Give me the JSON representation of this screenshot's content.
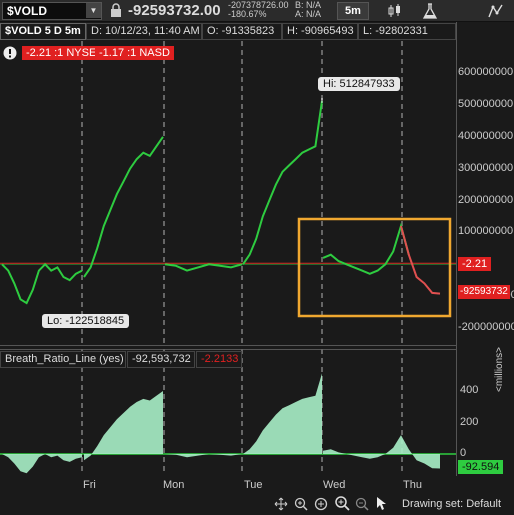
{
  "toolbar": {
    "symbol": "$VOLD",
    "last_price": "-92593732.00",
    "net_change": "-207378726.00",
    "pct_change": "-180.67%",
    "bid": "B: N/A",
    "ask": "A: N/A",
    "timeframe": "5m",
    "icons": [
      "lock-icon",
      "chart-style-icon",
      "flask-icon",
      "drawing-tools-icon"
    ]
  },
  "header": {
    "title": "$VOLD 5 D 5m",
    "date_time": "D: 10/12/23, 11:40 AM",
    "open": "O: -91335823",
    "high": "H: -90965493",
    "low": "L: -92802331",
    "nyse_ratio": "-2.21 :1 NYSE",
    "nasd_ratio": "-1.17 :1 NASD",
    "alert_icon": "exclamation-icon",
    "trend_icon": "trend-line-icon"
  },
  "main_chart": {
    "hi_label": "Hi: 512847933",
    "lo_label": "Lo: -122518845",
    "ratio_badge": "-2.21",
    "price_badge": "-92593732",
    "y_ticks": [
      "600000000",
      "500000000",
      "400000000",
      "300000000",
      "200000000",
      "100000000",
      "0",
      "-100000000",
      "-200000000"
    ],
    "colors": {
      "line": "#2ecc40",
      "zero_line": "#e02020",
      "highlight_box": "#f0a830",
      "badge_red": "#e02020"
    }
  },
  "lower_study": {
    "name": "Breath_Ratio_Line (yes)",
    "value": "-92,593,732",
    "ratio": "-2.2133",
    "y_ticks": [
      "400",
      "200",
      "0"
    ],
    "unit": "<millions>",
    "price_badge": "-92.594",
    "colors": {
      "fill": "#a8f0c8",
      "line": "#2ecc40"
    }
  },
  "x_axis": {
    "labels": [
      "Fri",
      "Mon",
      "Tue",
      "Wed",
      "Thu"
    ]
  },
  "bottom": {
    "drawing_set": "Drawing set: Default",
    "icons": [
      "pan-icon",
      "zoom-in-icon",
      "zoom-fit-icon",
      "zoom-out-icon",
      "cursor-icon"
    ]
  },
  "chart_data": {
    "type": "line",
    "title": "$VOLD 5 D 5m",
    "x": [
      "Thu",
      "Fri",
      "Mon",
      "Tue",
      "Wed",
      "Thu"
    ],
    "series": [
      {
        "name": "$VOLD",
        "points_by_session": [
          [
            0,
            -20,
            -60,
            -110,
            -122,
            -80,
            -20,
            0,
            -20,
            -10,
            -40,
            -50,
            -30,
            -20
          ],
          [
            -40,
            -10,
            50,
            120,
            170,
            220,
            260,
            300,
            330,
            350,
            340,
            370,
            400
          ],
          [
            0,
            -5,
            -20,
            -10,
            0,
            -5,
            -10,
            0
          ],
          [
            0,
            30,
            80,
            150,
            200,
            250,
            290,
            310,
            330,
            350,
            360,
            370,
            512
          ],
          [
            20,
            30,
            10,
            0,
            -10,
            -20,
            -30,
            -20,
            0,
            40,
            120,
            30,
            -40,
            -60,
            -90,
            -92
          ]
        ]
      }
    ],
    "ylim": [
      -220000000,
      640000000
    ],
    "hi": 512847933,
    "lo": -122518845,
    "last": -92593732
  }
}
